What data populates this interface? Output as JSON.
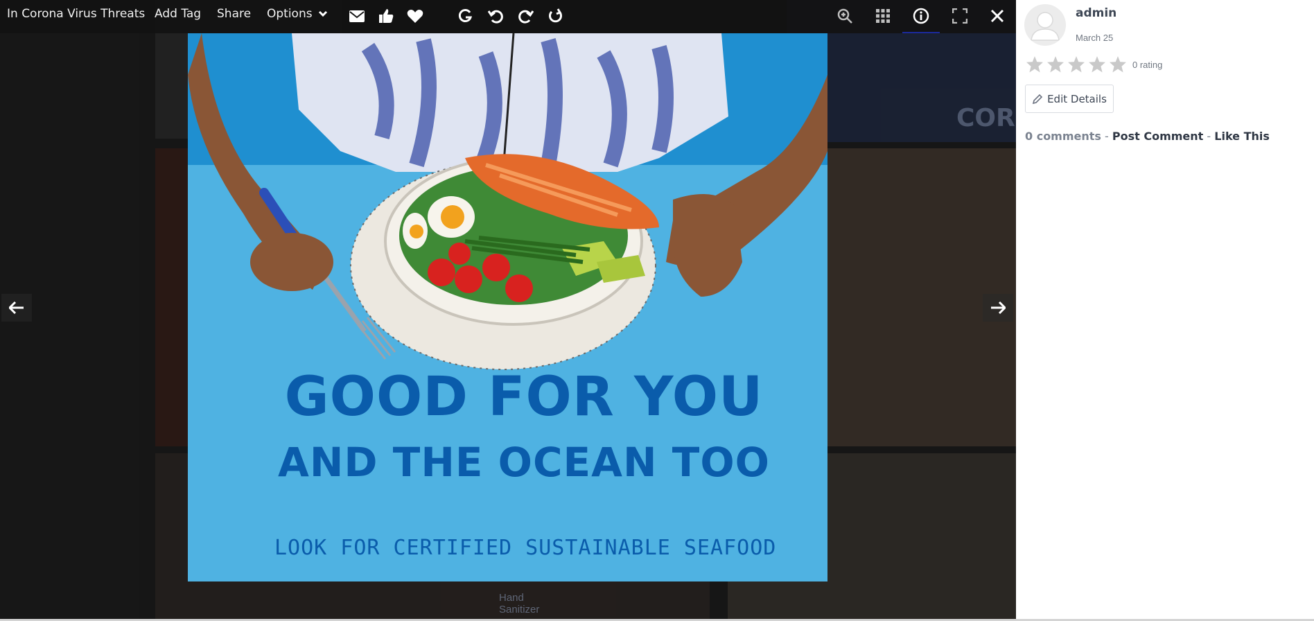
{
  "toolbar": {
    "album_title": "In Corona Virus Threats",
    "add_tag_label": "Add Tag",
    "share_label": "Share",
    "options_label": "Options",
    "icons": [
      "envelope-icon",
      "thumbs-up-icon",
      "heart-icon",
      "rotate-left-icon",
      "undo-icon",
      "redo-icon",
      "rotate-right-icon",
      "zoom-in-icon",
      "grid-icon",
      "info-icon",
      "fullscreen-icon",
      "close-icon"
    ],
    "active_icon": "info-icon"
  },
  "poster": {
    "headline_line1": "GOOD FOR YOU",
    "headline_line2": "AND THE OCEAN TOO",
    "tagline": "LOOK FOR CERTIFIED SUSTAINABLE SEAFOOD",
    "colors": {
      "background": "#4fb2e2",
      "headline": "#0a5cab"
    }
  },
  "background_tiles": {
    "partial_text": "CORO",
    "hand_sanitizer_text": "Hand Sanitizer"
  },
  "navigation": {
    "prev": "arrow-left-icon",
    "next": "arrow-right-icon"
  },
  "panel": {
    "user_name": "admin",
    "date": "March 25",
    "rating_count": "0 rating",
    "stars": 5,
    "rating_value": 0,
    "edit_label": "Edit Details",
    "comments_label": "0 comments",
    "separator": " - ",
    "post_comment_label": "Post Comment",
    "like_label": "Like This"
  }
}
